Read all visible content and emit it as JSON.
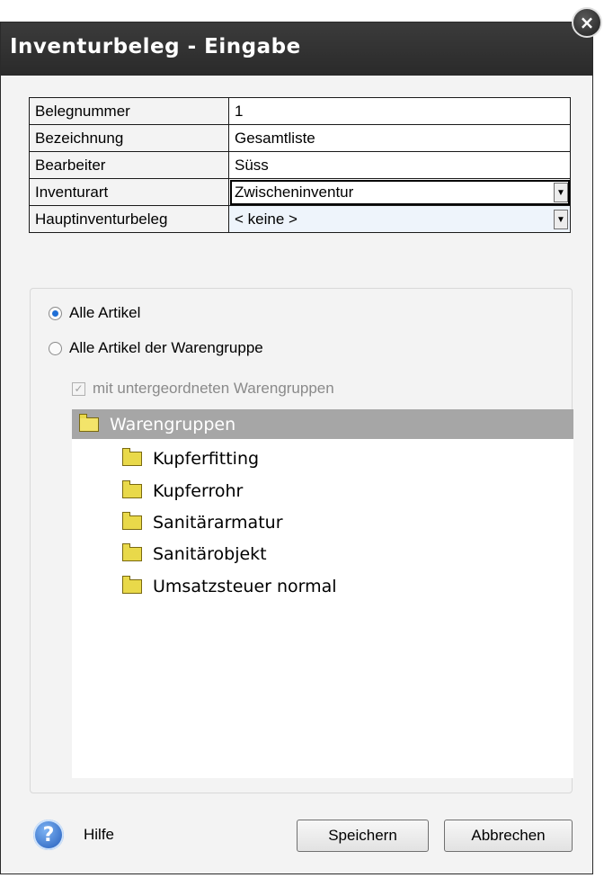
{
  "window": {
    "title": "Inventurbeleg - Eingabe",
    "close_glyph": "×"
  },
  "fields": [
    {
      "label": "Belegnummer",
      "value": "1",
      "type": "text"
    },
    {
      "label": "Bezeichnung",
      "value": "Gesamtliste",
      "type": "text"
    },
    {
      "label": "Bearbeiter",
      "value": "Süss",
      "type": "text"
    },
    {
      "label": "Inventurart",
      "value": "Zwischeninventur",
      "type": "combo"
    },
    {
      "label": "Hauptinventurbeleg",
      "value": "< keine >",
      "type": "combo"
    }
  ],
  "options": {
    "radio_all": "Alle Artikel",
    "radio_group": "Alle Artikel der Warengruppe",
    "checkbox_sub": "mit untergeordneten Warengruppen",
    "radio_all_selected": true,
    "checkbox_checked": true
  },
  "tree": {
    "root": "Warengruppen",
    "items": [
      "Kupferfitting",
      "Kupferrohr",
      "Sanitärarmatur",
      "Sanitärobjekt",
      "Umsatzsteuer normal"
    ]
  },
  "footer": {
    "help_label": "Hilfe",
    "help_glyph": "?",
    "save_label": "Speichern",
    "cancel_label": "Abbrechen"
  },
  "colors": {
    "titlebar": "#2f2f2f",
    "tree_header": "#a6a6a6",
    "folder": "#e9d94a",
    "radio_accent": "#1f6fd6"
  }
}
